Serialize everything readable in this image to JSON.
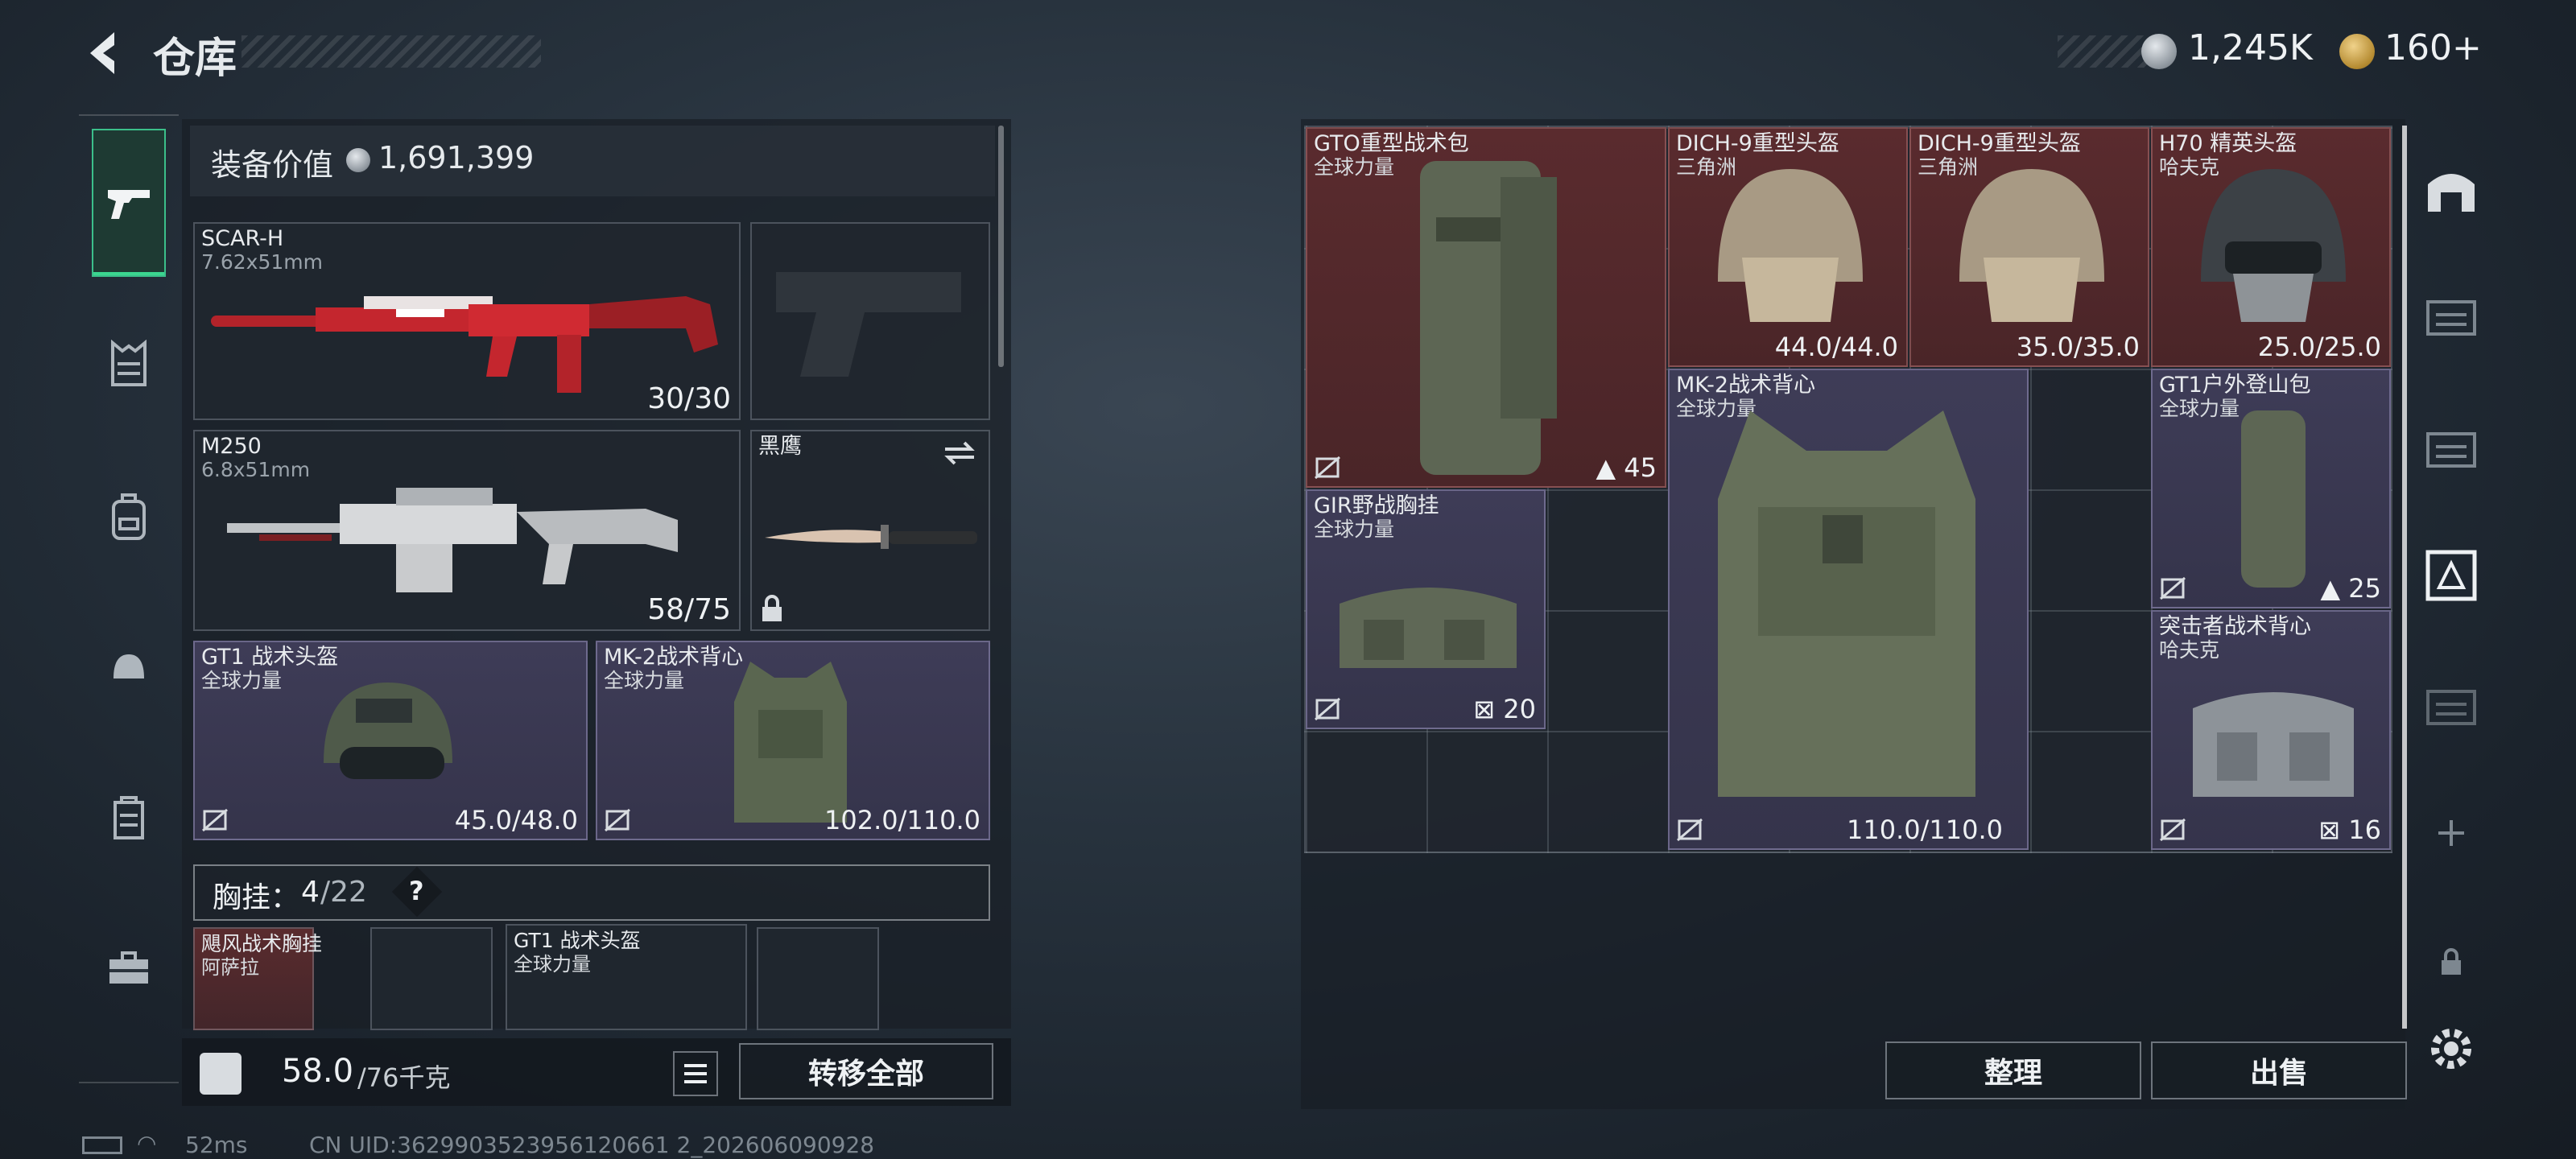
{
  "header": {
    "title": "仓库",
    "back_icon": "back-arrow-icon"
  },
  "currencies": [
    {
      "icon": "silver-coin-icon",
      "value": "1,245K",
      "color": "#b7bdc4"
    },
    {
      "icon": "gold-coin-icon",
      "value": "160+",
      "color": "#c9a24a"
    }
  ],
  "sidebar": {
    "tabs": [
      {
        "icon": "gun-icon",
        "active": true
      },
      {
        "icon": "chest-rig-icon"
      },
      {
        "icon": "backpack-icon"
      },
      {
        "icon": "helmet-icon"
      },
      {
        "icon": "container-icon"
      },
      {
        "icon": "toolbox-icon"
      }
    ]
  },
  "equipment": {
    "value_label": "装备价值",
    "value": "1,691,399",
    "scar": {
      "name": "SCAR-H",
      "caliber": "7.62x51mm",
      "ammo": "30/30"
    },
    "m250": {
      "name": "M250",
      "caliber": "6.8x51mm",
      "ammo": "58/75"
    },
    "knife": {
      "name": "黑鹰"
    },
    "helmet": {
      "name": "GT1 战术头盔",
      "faction": "全球力量",
      "durability": "45.0/48.0"
    },
    "vest": {
      "name": "MK-2战术背心",
      "faction": "全球力量",
      "durability": "102.0/110.0"
    }
  },
  "chest_rig": {
    "label": "胸挂：",
    "used": "4",
    "total": "/22",
    "help": "?",
    "items": [
      {
        "name": "飓风战术胸挂",
        "faction": "阿萨拉"
      },
      {
        "name": "GT1 战术头盔",
        "faction": "全球力量"
      }
    ]
  },
  "bottom": {
    "weight": "58.0",
    "weight_max": "/76千克",
    "transfer_all": "转移全部"
  },
  "storage": {
    "items": [
      {
        "name": "GTO重型战术包",
        "faction": "全球力量",
        "count": "45"
      },
      {
        "name": "DICH-9重型头盔",
        "faction": "三角洲",
        "durability": "44.0/44.0"
      },
      {
        "name": "DICH-9重型头盔",
        "faction": "三角洲",
        "durability": "35.0/35.0"
      },
      {
        "name": "H70 精英头盔",
        "faction": "哈夫克",
        "durability": "25.0/25.0"
      },
      {
        "name": "MK-2战术背心",
        "faction": "全球力量",
        "durability": "110.0/110.0"
      },
      {
        "name": "GT1户外登山包",
        "faction": "全球力量",
        "count": "25"
      },
      {
        "name": "GIR野战胸挂",
        "faction": "全球力量",
        "count": "20"
      },
      {
        "name": "突击者战术背心",
        "faction": "哈夫克",
        "count": "16"
      }
    ],
    "sort": "整理",
    "sell": "出售"
  },
  "right_tabs": [
    "warehouse-icon",
    "shelf-1-icon",
    "shelf-2-icon",
    "vault-icon",
    "shelf-3-icon",
    "add-icon",
    "lock-icon",
    "settings-icon"
  ],
  "status": {
    "ping": "52ms",
    "uid": "CN UID:3629903523956120661 2_202606090928"
  }
}
